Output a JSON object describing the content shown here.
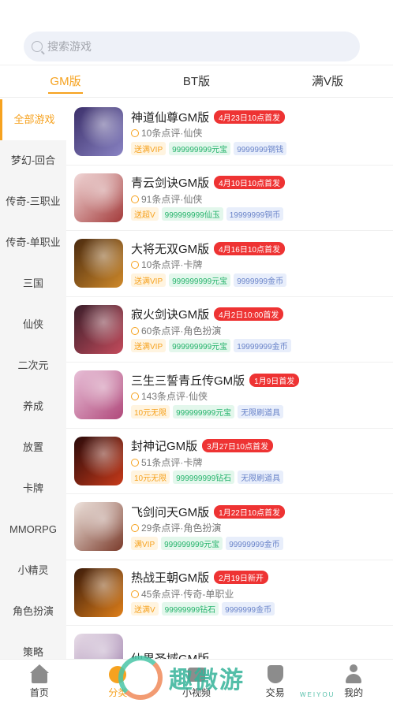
{
  "search": {
    "placeholder": "搜索游戏"
  },
  "tabs": [
    {
      "label": "GM版",
      "active": true
    },
    {
      "label": "BT版",
      "active": false
    },
    {
      "label": "满V版",
      "active": false
    }
  ],
  "sidebar": [
    {
      "label": "全部游戏",
      "active": true
    },
    {
      "label": "梦幻-回合"
    },
    {
      "label": "传奇-三职业"
    },
    {
      "label": "传奇-单职业"
    },
    {
      "label": "三国"
    },
    {
      "label": "仙侠"
    },
    {
      "label": "二次元"
    },
    {
      "label": "养成"
    },
    {
      "label": "放置"
    },
    {
      "label": "卡牌"
    },
    {
      "label": "MMORPG"
    },
    {
      "label": "小精灵"
    },
    {
      "label": "角色扮演"
    },
    {
      "label": "策略"
    }
  ],
  "games": [
    {
      "name": "神道仙尊GM版",
      "launch": "4月23日10点首发",
      "comments": "10条点评·仙侠",
      "tags": [
        "送满VIP",
        "999999999元宝",
        "9999999钢钱"
      ],
      "thumb": [
        "#3b2f6a",
        "#8a84c4"
      ]
    },
    {
      "name": "青云剑诀GM版",
      "launch": "4月10日10点首发",
      "comments": "91条点评·仙侠",
      "tags": [
        "送超V",
        "999999999仙玉",
        "19999999铜币"
      ],
      "thumb": [
        "#f2d9d9",
        "#a33a3a"
      ]
    },
    {
      "name": "大将无双GM版",
      "launch": "4月16日10点首发",
      "comments": "10条点评·卡牌",
      "tags": [
        "送满VIP",
        "999999999元宝",
        "9999999金币"
      ],
      "thumb": [
        "#4a2a0f",
        "#d08a2a"
      ]
    },
    {
      "name": "寂火剑诀GM版",
      "launch": "4月2日10:00首发",
      "comments": "60条点评·角色扮演",
      "tags": [
        "送满VIP",
        "999999999元宝",
        "19999999金币"
      ],
      "thumb": [
        "#3a1e2a",
        "#c44b5c"
      ]
    },
    {
      "name": "三生三誓青丘传GM版",
      "launch": "1月9日首发",
      "comments": "143条点评·仙侠",
      "tags": [
        "10元无限",
        "999999999元宝",
        "无限刷道具"
      ],
      "thumb": [
        "#e8c0d8",
        "#b0487a"
      ]
    },
    {
      "name": "封神记GM版",
      "launch": "3月27日10点首发",
      "comments": "51条点评·卡牌",
      "tags": [
        "10元无限",
        "999999999钻石",
        "无限刷道具"
      ],
      "thumb": [
        "#2a0a0a",
        "#c83a1a"
      ]
    },
    {
      "name": "飞剑问天GM版",
      "launch": "1月22日10点首发",
      "comments": "29条点评·角色扮演",
      "tags": [
        "满VIP",
        "999999999元宝",
        "99999999金币"
      ],
      "thumb": [
        "#f0e6e0",
        "#7a3a2a"
      ]
    },
    {
      "name": "热战王朝GM版",
      "launch": "2月19日新开",
      "comments": "45条点评·传奇-单职业",
      "tags": [
        "送满V",
        "99999999钻石",
        "9999999金币"
      ],
      "thumb": [
        "#3a1a0a",
        "#e0801a"
      ]
    },
    {
      "name": "仙界圣域GM版",
      "launch": "",
      "comments": "",
      "tags": [],
      "thumb": [
        "#e8dde8",
        "#9a7aa8"
      ]
    }
  ],
  "bottom_nav": [
    {
      "label": "首页",
      "icon": "home-icon",
      "active": false
    },
    {
      "label": "分类",
      "icon": "category-icon",
      "active": true
    },
    {
      "label": "小视频",
      "icon": "video-icon",
      "active": false
    },
    {
      "label": "交易",
      "icon": "trade-icon",
      "active": false
    },
    {
      "label": "我的",
      "icon": "profile-icon",
      "active": false
    }
  ],
  "watermark": {
    "text": "趣微游",
    "sub": "WEIYOU"
  },
  "colors": {
    "accent": "#f6a21f",
    "badge": "#e33333",
    "green_tag": "#25b36b",
    "blue_tag": "#6a84c9"
  }
}
